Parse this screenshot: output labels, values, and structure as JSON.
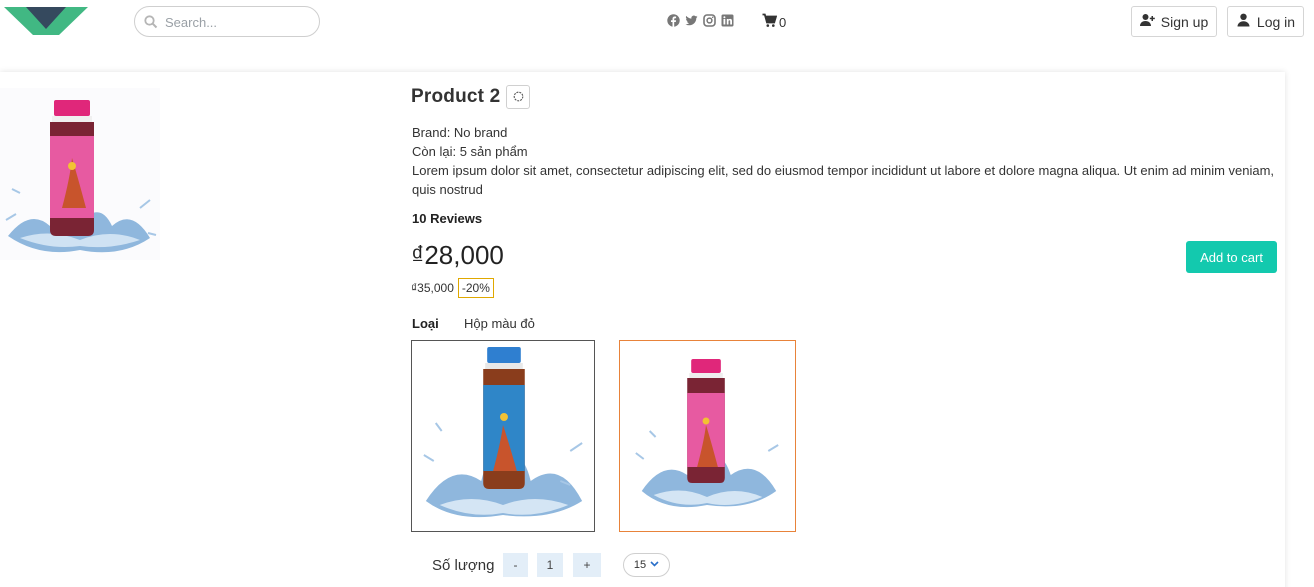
{
  "header": {
    "logo_icon": "vue-logo-icon",
    "search": {
      "placeholder": "Search...",
      "value": ""
    },
    "social_icons": [
      "facebook-icon",
      "twitter-icon",
      "instagram-icon",
      "linkedin-icon"
    ],
    "cart": {
      "icon": "cart-icon",
      "count": "0"
    },
    "signup_label": "Sign up",
    "login_label": "Log in"
  },
  "product": {
    "title": "Product 2",
    "brand": "Brand: No brand",
    "stock": "Còn lại: 5 sản phẩm",
    "description": "Lorem ipsum dolor sit amet, consectetur adipiscing elit, sed do eiusmod tempor incididunt ut labore et dolore magna aliqua. Ut enim ad minim veniam, quis nostrud",
    "reviews": "10 Reviews",
    "price": "₫28,000",
    "old_price": "₫35,000",
    "discount": "-20%",
    "add_to_cart_label": "Add to cart",
    "variant_label": "Loại",
    "variant_name": "Hộp màu đỏ",
    "variants": [
      {
        "cap_color": "#2f7fd0",
        "label_color": "#2f86c8",
        "selected": false
      },
      {
        "cap_color": "#e0277a",
        "label_color": "#e75aa1",
        "selected": true
      }
    ],
    "quantity": {
      "label": "Số lượng",
      "minus": "-",
      "value": "1",
      "plus": "+",
      "max": "15"
    }
  },
  "colors": {
    "accent": "#13c9ae",
    "discount_border": "#e0a800",
    "selected_border": "#e8833a",
    "logo_green": "#41b883",
    "logo_dark": "#35495e"
  }
}
